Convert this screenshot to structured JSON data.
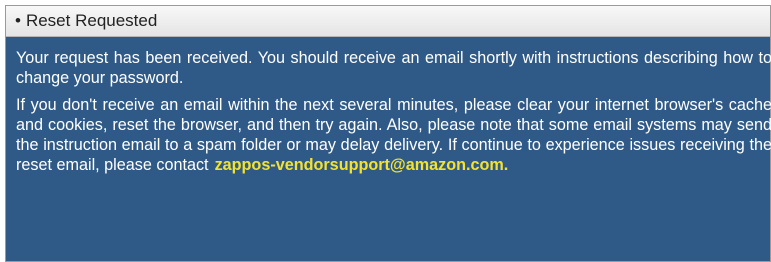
{
  "panel": {
    "bullet": "•",
    "title": "Reset Requested",
    "paragraph1": "Your request has been received. You should receive an email shortly with instructions describing how to change your password.",
    "paragraph2": "If you don't receive an email within the next several minutes, please clear your internet browser's cache and cookies, reset the browser, and then try again.  Also, please note that some email systems may send the instruction email to a spam folder or may delay delivery.  If continue to experience issues receiving the reset email, please contact",
    "contact_email": "zappos-vendorsupport@amazon.com."
  },
  "colors": {
    "panel_background": "#2f5a87",
    "header_background": "#f0f0f0",
    "body_text": "#ffffff",
    "email_link": "#f3e22f"
  }
}
